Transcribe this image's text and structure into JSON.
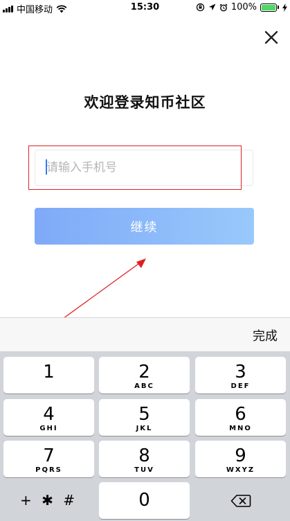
{
  "status_bar": {
    "carrier": "中国移动",
    "time": "15:30",
    "battery_percent": "100%",
    "battery_level": 1.0,
    "battery_color": "#4cd964"
  },
  "close": {
    "icon": "close-icon"
  },
  "page": {
    "title": "欢迎登录知币社区"
  },
  "phone_input": {
    "placeholder": "请输入手机号",
    "value": ""
  },
  "continue_button": {
    "label": "继续",
    "gradient_start": "#7fa9f8",
    "gradient_end": "#98c9fb"
  },
  "annotation": {
    "highlight_color": "#e02020"
  },
  "keyboard": {
    "done_label": "完成",
    "keys": [
      {
        "digit": "1",
        "letters": ""
      },
      {
        "digit": "2",
        "letters": "ABC"
      },
      {
        "digit": "3",
        "letters": "DEF"
      },
      {
        "digit": "4",
        "letters": "GHI"
      },
      {
        "digit": "5",
        "letters": "JKL"
      },
      {
        "digit": "6",
        "letters": "MNO"
      },
      {
        "digit": "7",
        "letters": "PQRS"
      },
      {
        "digit": "8",
        "letters": "TUV"
      },
      {
        "digit": "9",
        "letters": "WXYZ"
      }
    ],
    "symbols_label": "+ ✱ #",
    "zero": "0",
    "backspace_icon": "backspace-icon"
  }
}
